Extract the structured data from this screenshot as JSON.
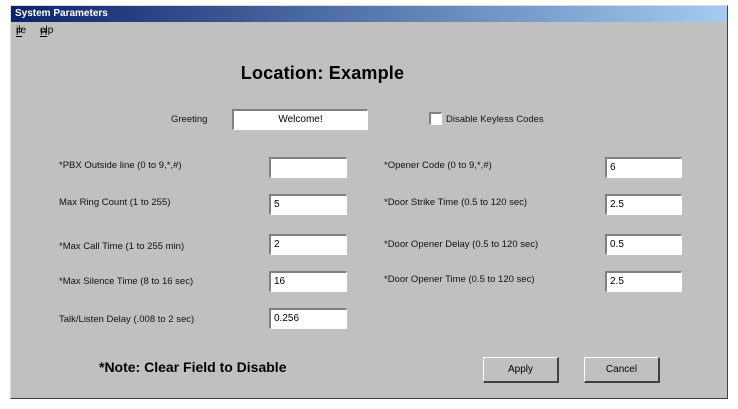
{
  "window": {
    "title": "System Parameters"
  },
  "menu": {
    "file": "File",
    "help": "Help"
  },
  "heading": "Location:  Example",
  "greeting": {
    "label": "Greeting",
    "value": "Welcome!"
  },
  "disable_keyless": {
    "label": "Disable Keyless Codes",
    "checked": false
  },
  "left_fields": [
    {
      "label": "*PBX Outside line (0 to 9,*,#)",
      "value": ""
    },
    {
      "label": "Max Ring Count (1 to 255)",
      "value": "5"
    },
    {
      "label": "*Max Call Time (1 to 255 min)",
      "value": "2"
    },
    {
      "label": "*Max Silence Time (8 to 16 sec)",
      "value": "16"
    },
    {
      "label": "Talk/Listen Delay (.008 to 2 sec)",
      "value": "0.256"
    }
  ],
  "right_fields": [
    {
      "label": "*Opener Code (0 to 9,*,#)",
      "value": "6"
    },
    {
      "label": "*Door Strike Time (0.5 to 120 sec)",
      "value": "2.5"
    },
    {
      "label": "*Door Opener Delay (0.5 to 120 sec)",
      "value": "0.5"
    },
    {
      "label": "*Door Opener Time (0.5 to 120 sec)",
      "value": "2.5"
    }
  ],
  "note": "*Note: Clear Field to Disable",
  "buttons": {
    "apply": "Apply",
    "cancel": "Cancel"
  }
}
